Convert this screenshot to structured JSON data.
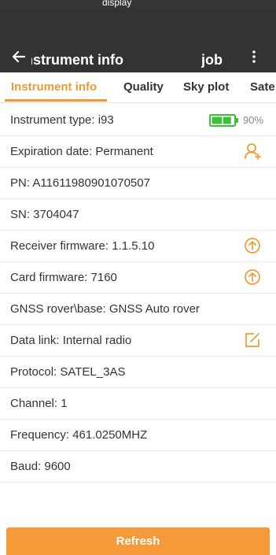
{
  "colors": {
    "app_bar": "#333333",
    "accent": "#f09a37",
    "battery_fill": "#3fbe3a",
    "button": "#f49a38"
  },
  "status_bar": {
    "text": "display"
  },
  "header": {
    "title": "Instrument info",
    "job_label": "job",
    "back_icon": "arrow-left-icon",
    "more_icon": "vertical-dots-icon"
  },
  "tabs": [
    {
      "label": "Instrument info",
      "active": true
    },
    {
      "label": "Quality",
      "active": false
    },
    {
      "label": "Sky plot",
      "active": false
    },
    {
      "label": "Sate",
      "active": false
    }
  ],
  "rows": [
    {
      "label": "Instrument type: i93",
      "icon": "battery-icon",
      "battery_level": 0.9,
      "battery_text": "90%"
    },
    {
      "label": "Expiration date: Permanent",
      "icon": "add-user-icon"
    },
    {
      "label": "PN: A11611980901070507"
    },
    {
      "label": "SN: 3704047"
    },
    {
      "label": "Receiver firmware: 1.1.5.10",
      "icon": "upgrade-icon"
    },
    {
      "label": "Card firmware: 7160",
      "icon": "upgrade-icon"
    },
    {
      "label": "GNSS rover\\base: GNSS Auto rover"
    },
    {
      "label": "Data link: Internal radio",
      "icon": "edit-icon"
    },
    {
      "label": "Protocol: SATEL_3AS"
    },
    {
      "label": "Channel: 1"
    },
    {
      "label": "Frequency: 461.0250MHZ"
    },
    {
      "label": "Baud: 9600"
    }
  ],
  "footer": {
    "refresh_label": "Refresh"
  }
}
